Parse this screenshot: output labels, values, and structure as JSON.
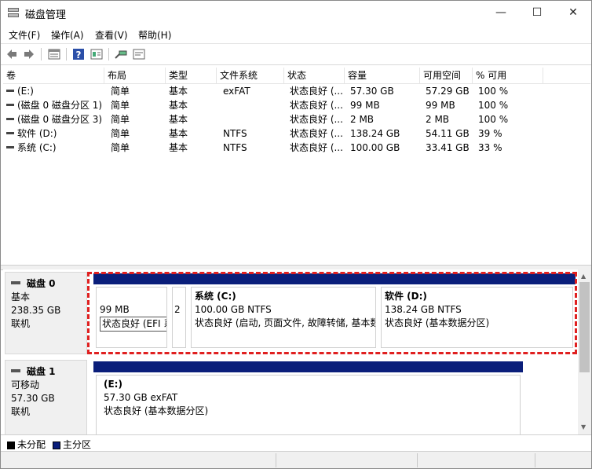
{
  "window": {
    "title": "磁盘管理",
    "minimize_glyph": "—",
    "maximize_glyph": "☐",
    "close_glyph": "✕"
  },
  "menu": [
    "文件(F)",
    "操作(A)",
    "查看(V)",
    "帮助(H)"
  ],
  "toolbar_icons": [
    "back-icon",
    "forward-icon",
    "list-view-icon",
    "help-icon",
    "properties-icon",
    "connect-icon",
    "console-icon"
  ],
  "columns": [
    "卷",
    "布局",
    "类型",
    "文件系统",
    "状态",
    "容量",
    "可用空间",
    "% 可用"
  ],
  "volumes": [
    {
      "name": "(E:)",
      "layout": "简单",
      "type": "基本",
      "fs": "exFAT",
      "status": "状态良好 (...",
      "capacity": "57.30 GB",
      "free": "57.29 GB",
      "pct": "100 %"
    },
    {
      "name": "(磁盘 0 磁盘分区 1)",
      "layout": "简单",
      "type": "基本",
      "fs": "",
      "status": "状态良好 (...",
      "capacity": "99 MB",
      "free": "99 MB",
      "pct": "100 %"
    },
    {
      "name": "(磁盘 0 磁盘分区 3)",
      "layout": "简单",
      "type": "基本",
      "fs": "",
      "status": "状态良好 (...",
      "capacity": "2 MB",
      "free": "2 MB",
      "pct": "100 %"
    },
    {
      "name": "软件 (D:)",
      "layout": "简单",
      "type": "基本",
      "fs": "NTFS",
      "status": "状态良好 (...",
      "capacity": "138.24 GB",
      "free": "54.11 GB",
      "pct": "39 %"
    },
    {
      "name": "系统 (C:)",
      "layout": "简单",
      "type": "基本",
      "fs": "NTFS",
      "status": "状态良好 (...",
      "capacity": "100.00 GB",
      "free": "33.41 GB",
      "pct": "33 %"
    }
  ],
  "disks": [
    {
      "name": "磁盘 0",
      "kind": "基本",
      "size": "238.35 GB",
      "state": "联机",
      "partitions": [
        {
          "title": "",
          "size": "99 MB",
          "status": "状态良好 (EFI 系统分区)"
        },
        {
          "title": "",
          "size": "2",
          "status": ""
        },
        {
          "title": "系统  (C:)",
          "size": "100.00 GB NTFS",
          "status": "状态良好 (启动, 页面文件, 故障转储, 基本数据分区)"
        },
        {
          "title": "软件  (D:)",
          "size": "138.24 GB NTFS",
          "status": "状态良好 (基本数据分区)"
        }
      ]
    },
    {
      "name": "磁盘 1",
      "kind": "可移动",
      "size": "57.30 GB",
      "state": "联机",
      "partitions": [
        {
          "title": "(E:)",
          "size": "57.30 GB exFAT",
          "status": "状态良好 (基本数据分区)"
        }
      ]
    }
  ],
  "legend": [
    {
      "label": "未分配",
      "color": "#000000"
    },
    {
      "label": "主分区",
      "color": "#0a1e7a"
    }
  ],
  "colors": {
    "partition_bar": "#0a1e7a",
    "highlight": "#e02020"
  }
}
